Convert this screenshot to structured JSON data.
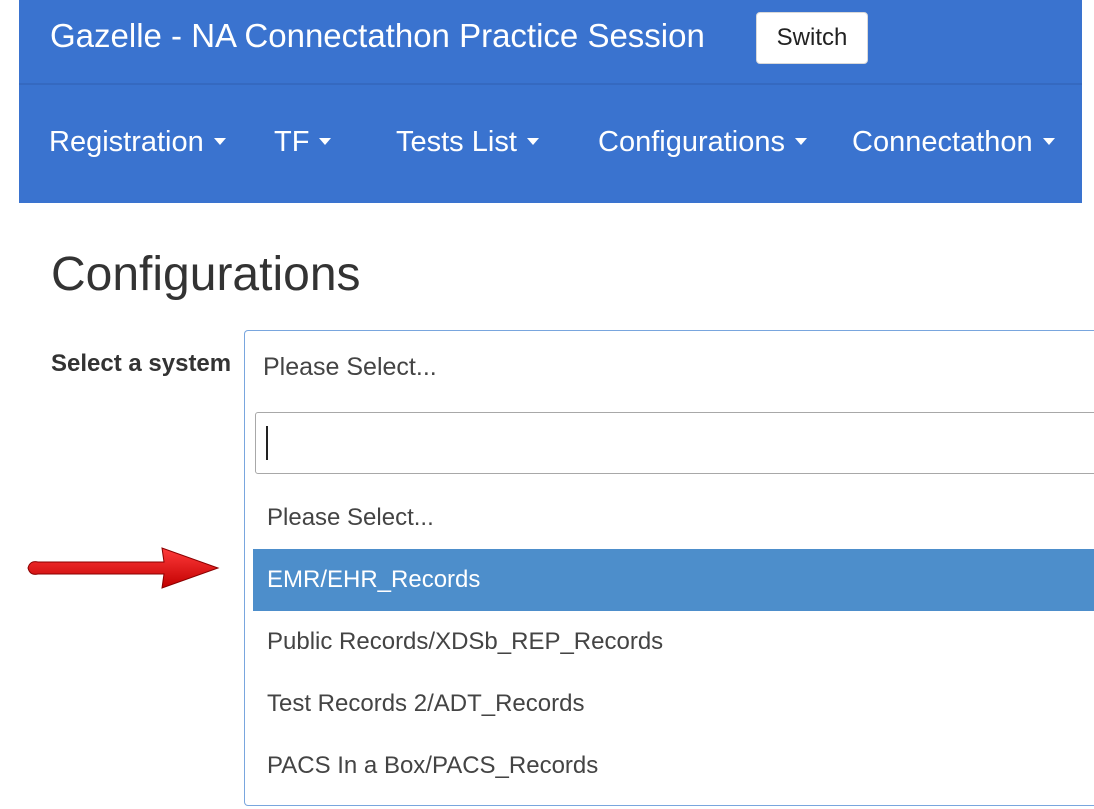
{
  "header": {
    "app_title": "Gazelle - NA Connectathon Practice Session",
    "switch_label": "Switch",
    "colors": {
      "bar": "#3a73cf",
      "highlight": "#4d8ecb",
      "annotation_arrow": "#e10b0b"
    }
  },
  "nav": {
    "items": [
      {
        "label": "Registration"
      },
      {
        "label": "TF"
      },
      {
        "label": "Tests List"
      },
      {
        "label": "Configurations"
      },
      {
        "label": "Connectathon"
      }
    ]
  },
  "page": {
    "title": "Configurations",
    "select_label": "Select a system",
    "select_value": "Please Select...",
    "search_value": "",
    "options": [
      {
        "label": "Please Select...",
        "highlighted": false
      },
      {
        "label": "EMR/EHR_Records",
        "highlighted": true
      },
      {
        "label": "Public Records/XDSb_REP_Records",
        "highlighted": false
      },
      {
        "label": "Test Records 2/ADT_Records",
        "highlighted": false
      },
      {
        "label": "PACS In a Box/PACS_Records",
        "highlighted": false
      }
    ]
  },
  "annotation": {
    "icon": "red-arrow-icon"
  }
}
